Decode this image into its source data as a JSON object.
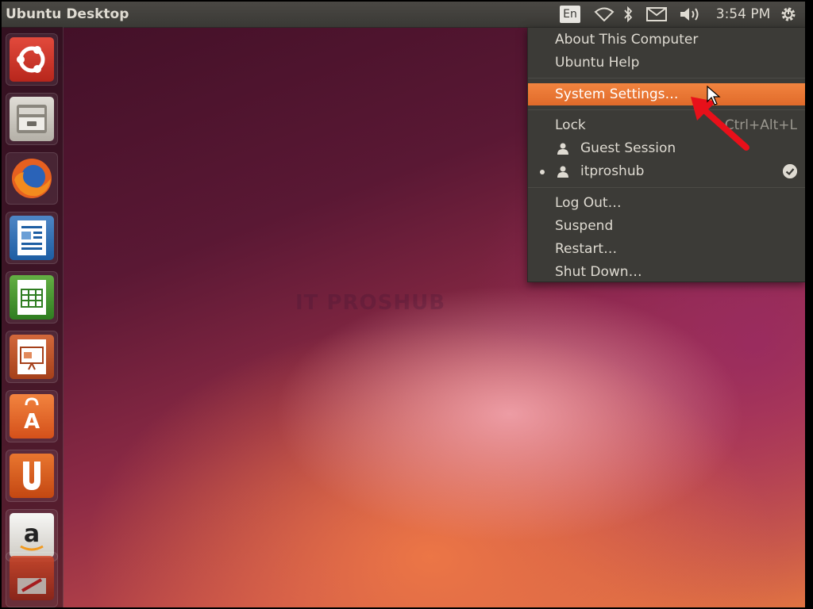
{
  "panel": {
    "title": "Ubuntu Desktop",
    "keyboard_layout": "En",
    "clock": "3:54 PM"
  },
  "launcher": {
    "items": [
      {
        "icon": "ubuntu-dash-icon"
      },
      {
        "icon": "file-manager-icon"
      },
      {
        "icon": "firefox-icon"
      },
      {
        "icon": "libreoffice-writer-icon"
      },
      {
        "icon": "libreoffice-calc-icon"
      },
      {
        "icon": "libreoffice-impress-icon"
      },
      {
        "icon": "software-center-icon"
      },
      {
        "icon": "ubuntu-one-icon"
      },
      {
        "icon": "amazon-icon"
      },
      {
        "icon": "system-settings-icon"
      }
    ]
  },
  "menu": {
    "about": "About This Computer",
    "help": "Ubuntu Help",
    "system_settings": "System Settings…",
    "lock": "Lock",
    "lock_shortcut": "Ctrl+Alt+L",
    "guest": "Guest Session",
    "user": "itproshub",
    "logout": "Log Out…",
    "suspend": "Suspend",
    "restart": "Restart…",
    "shutdown": "Shut Down…"
  },
  "watermark": "IT PROSHUB",
  "colors": {
    "accent": "#e9762f",
    "panel": "#3c3b37",
    "annotation_arrow": "#e8101a"
  }
}
